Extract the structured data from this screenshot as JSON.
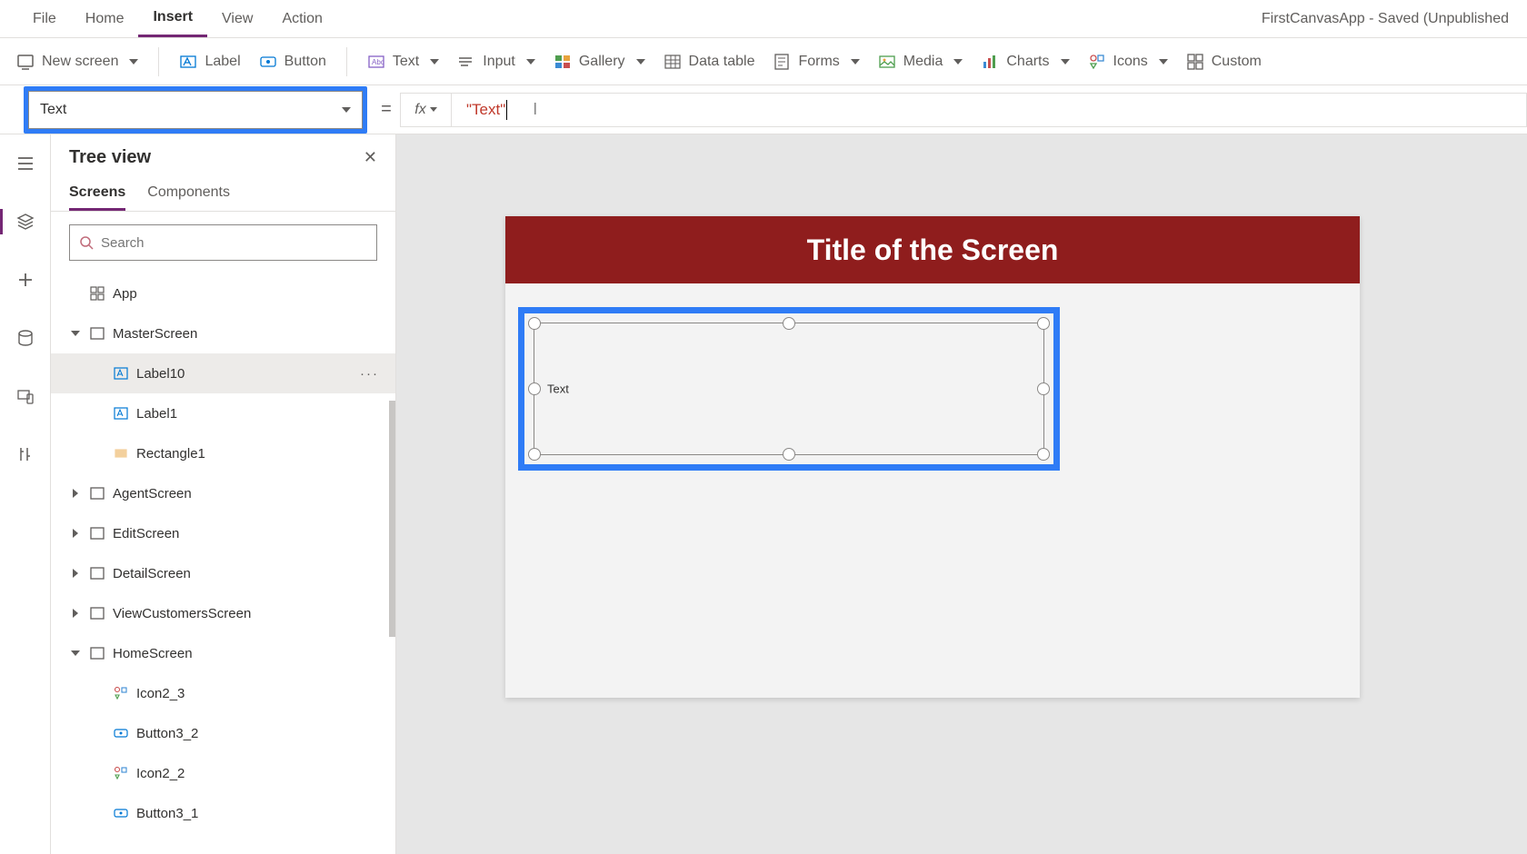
{
  "app_title": "FirstCanvasApp - Saved (Unpublished",
  "menu": {
    "file": "File",
    "home": "Home",
    "insert": "Insert",
    "view": "View",
    "action": "Action",
    "active": "insert"
  },
  "ribbon": {
    "new_screen": "New screen",
    "label": "Label",
    "button": "Button",
    "text": "Text",
    "input": "Input",
    "gallery": "Gallery",
    "data_table": "Data table",
    "forms": "Forms",
    "media": "Media",
    "charts": "Charts",
    "icons": "Icons",
    "custom": "Custom"
  },
  "formula": {
    "property": "Text",
    "fx": "fx",
    "value": "\"Text\""
  },
  "tree": {
    "title": "Tree view",
    "tabs": {
      "screens": "Screens",
      "components": "Components",
      "active": "screens"
    },
    "search_placeholder": "Search",
    "items": [
      {
        "label": "App",
        "icon": "app",
        "depth": 0
      },
      {
        "label": "MasterScreen",
        "icon": "screen",
        "depth": 0,
        "expand": "down"
      },
      {
        "label": "Label10",
        "icon": "label",
        "depth": 1,
        "selected": true,
        "more": true
      },
      {
        "label": "Label1",
        "icon": "label",
        "depth": 1
      },
      {
        "label": "Rectangle1",
        "icon": "rect",
        "depth": 1
      },
      {
        "label": "AgentScreen",
        "icon": "screen",
        "depth": 0,
        "expand": "right"
      },
      {
        "label": "EditScreen",
        "icon": "screen",
        "depth": 0,
        "expand": "right"
      },
      {
        "label": "DetailScreen",
        "icon": "screen",
        "depth": 0,
        "expand": "right"
      },
      {
        "label": "ViewCustomersScreen",
        "icon": "screen",
        "depth": 0,
        "expand": "right"
      },
      {
        "label": "HomeScreen",
        "icon": "screen",
        "depth": 0,
        "expand": "down"
      },
      {
        "label": "Icon2_3",
        "icon": "iconctl",
        "depth": 1
      },
      {
        "label": "Button3_2",
        "icon": "buttonctl",
        "depth": 1
      },
      {
        "label": "Icon2_2",
        "icon": "iconctl",
        "depth": 1
      },
      {
        "label": "Button3_1",
        "icon": "buttonctl",
        "depth": 1
      }
    ]
  },
  "canvas": {
    "screen_title": "Title of the Screen",
    "label_text": "Text"
  },
  "colors": {
    "highlight": "#2f7cf6",
    "title_bg": "#8f1d1d",
    "accent": "#742774"
  }
}
